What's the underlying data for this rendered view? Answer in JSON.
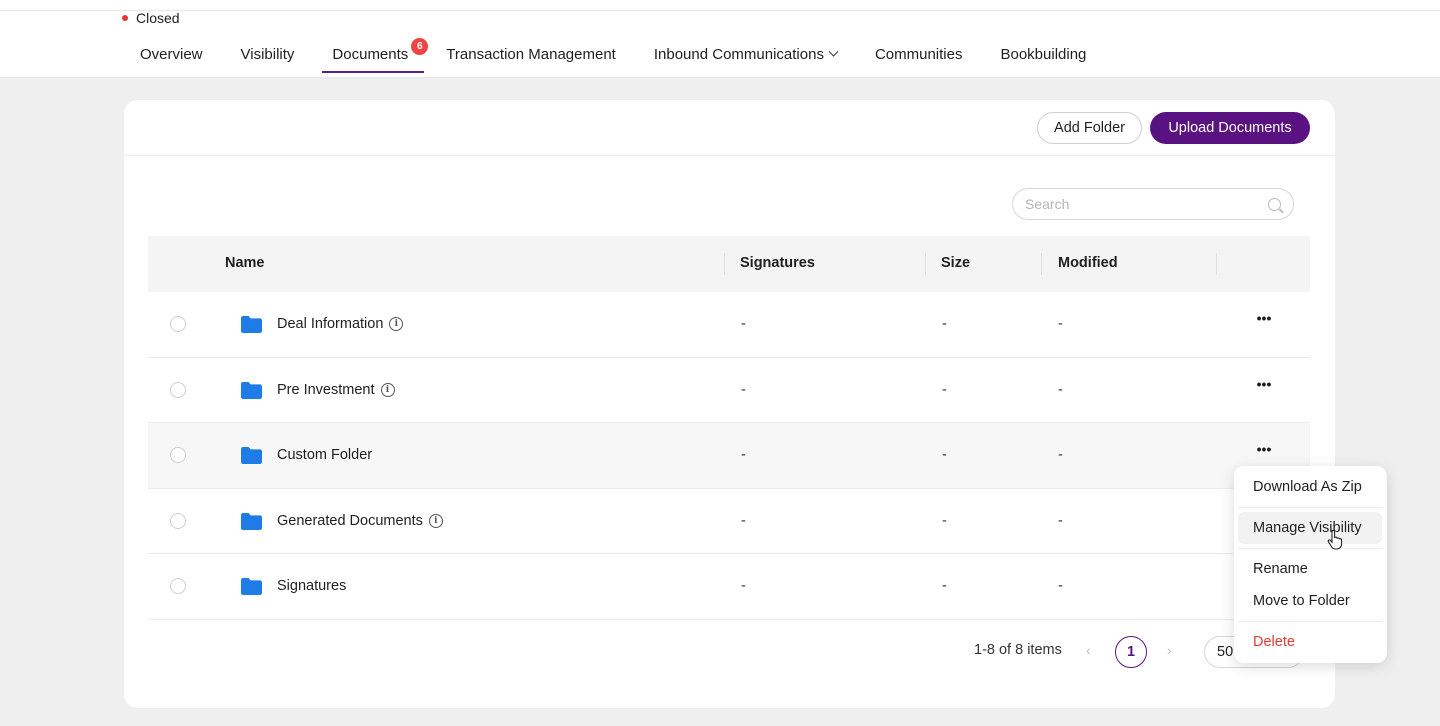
{
  "header": {
    "status": "Closed"
  },
  "tabs": [
    {
      "label": "Overview"
    },
    {
      "label": "Visibility"
    },
    {
      "label": "Documents",
      "badge": "6",
      "active": true
    },
    {
      "label": "Transaction Management"
    },
    {
      "label": "Inbound Communications",
      "dropdown": true
    },
    {
      "label": "Communities"
    },
    {
      "label": "Bookbuilding"
    }
  ],
  "toolbar": {
    "add_folder": "Add Folder",
    "upload_documents": "Upload Documents"
  },
  "search": {
    "placeholder": "Search",
    "value": ""
  },
  "table": {
    "columns": {
      "name": "Name",
      "signatures": "Signatures",
      "size": "Size",
      "modified": "Modified"
    },
    "rows": [
      {
        "name": "Deal Information",
        "info": true,
        "signatures": "-",
        "size": "-",
        "modified": "-"
      },
      {
        "name": "Pre Investment",
        "info": true,
        "signatures": "-",
        "size": "-",
        "modified": "-"
      },
      {
        "name": "Custom Folder",
        "info": false,
        "signatures": "-",
        "size": "-",
        "modified": "-"
      },
      {
        "name": "Generated Documents",
        "info": true,
        "signatures": "-",
        "size": "-",
        "modified": "-"
      },
      {
        "name": "Signatures",
        "info": false,
        "signatures": "-",
        "size": "-",
        "modified": "-"
      }
    ]
  },
  "pagination": {
    "summary": "1-8 of 8 items",
    "current_page": "1",
    "page_size": "50"
  },
  "context_menu": {
    "download_zip": "Download As Zip",
    "manage_visibility": "Manage Visibility",
    "rename": "Rename",
    "move_to_folder": "Move to Folder",
    "delete": "Delete"
  },
  "colors": {
    "brand": "#5a1283",
    "folder": "#1f7be6",
    "danger": "#e53935",
    "badge": "#ef4545"
  }
}
